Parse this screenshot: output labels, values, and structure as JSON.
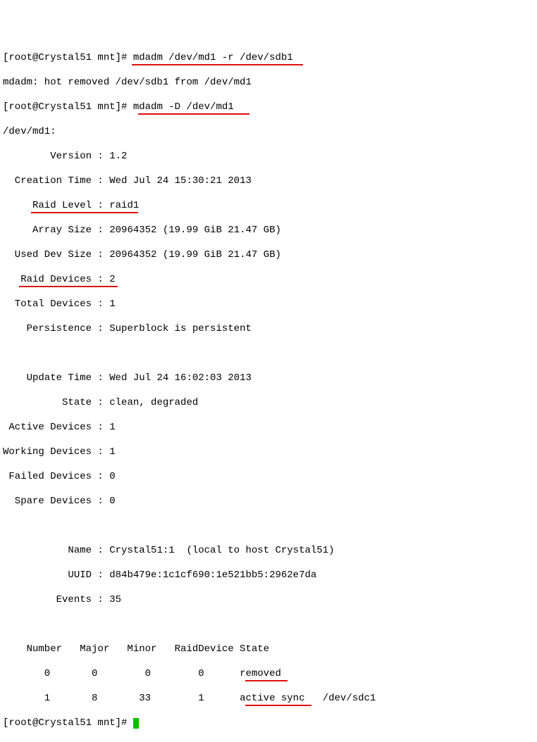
{
  "prompt1_prefix": "[root@Crystal51 mnt]#",
  "cmd1": " mdadm /dev/md1 -r /dev/sdb1",
  "out_hotremove": "mdadm: hot removed /dev/sdb1 from /dev/md1",
  "prompt2_prefix": "[root@Crystal51 mnt]# ",
  "cmd2": "mdadm -D /dev/md1",
  "detail": {
    "device": "/dev/md1:",
    "version_label": "        Version : ",
    "version_value": "1.2",
    "creation_label": "  Creation Time : ",
    "creation_value": "Wed Jul 24 15:30:21 2013",
    "raid_level_label": "     Raid Level : ",
    "raid_level_value": "raid1",
    "array_size_label": "     Array Size : ",
    "array_size_value": "20964352 (19.99 GiB 21.47 GB)",
    "used_dev_label": "  Used Dev Size : ",
    "used_dev_value": "20964352 (19.99 GiB 21.47 GB)",
    "raid_devices_label": "   Raid Devices : ",
    "raid_devices_value": "2",
    "total_devices_label": "  Total Devices : ",
    "total_devices_value": "1",
    "persistence_label": "    Persistence : ",
    "persistence_value": "Superblock is persistent",
    "update_time_label": "    Update Time : ",
    "update_time_value": "Wed Jul 24 16:02:03 2013",
    "state_label": "          State : ",
    "state_value": "clean, degraded",
    "active_dev_label": " Active Devices : ",
    "active_dev_value": "1",
    "working_dev_label": "Working Devices : ",
    "working_dev_value": "1",
    "failed_dev_label": " Failed Devices : ",
    "failed_dev_value": "0",
    "spare_dev_label": "  Spare Devices : ",
    "spare_dev_value": "0",
    "name_label": "           Name : ",
    "name_value": "Crystal51:1  (local to host Crystal51)",
    "uuid_label": "           UUID : ",
    "uuid_value": "d84b479e:1c1cf690:1e521bb5:2962e7da",
    "events_label": "         Events : ",
    "events_value": "35"
  },
  "table": {
    "header": "    Number   Major   Minor   RaidDevice State",
    "row0": {
      "prefix": "       0       0        0        0      ",
      "state": "removed"
    },
    "row1": {
      "prefix": "       1       8       33        1      ",
      "state": "active sync",
      "dev": "   /dev/sdc1"
    }
  },
  "prompt3": "[root@Crystal51 mnt]# "
}
